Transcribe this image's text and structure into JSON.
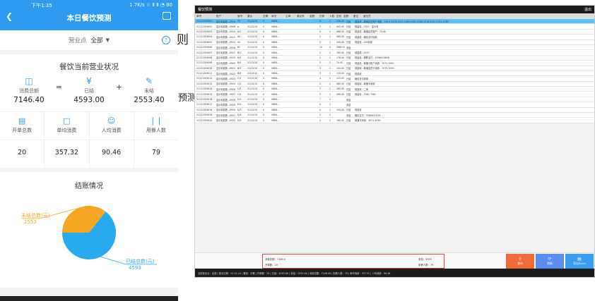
{
  "phone": {
    "status": {
      "time": "下午1:35",
      "net": "1.7K/s ☆ Ⅱ Ⅱ ◔ 80"
    },
    "title": "本日餐饮预测",
    "filter": {
      "label": "营业点",
      "value": "全部"
    },
    "summary": {
      "title": "餐饮当前营业状况",
      "consumption_label": "消费总额",
      "consumption_value": "7146.40",
      "settled_label": "已结",
      "settled_value": "4593.00",
      "unsettled_label": "未结",
      "unsettled_value": "2553.40",
      "op_equals": "=",
      "op_plus": "+"
    },
    "metrics": [
      {
        "label": "开单总数",
        "value": "20"
      },
      {
        "label": "单均消费",
        "value": "357.32"
      },
      {
        "label": "人均消费",
        "value": "90.46"
      },
      {
        "label": "用餐人数",
        "value": "79"
      }
    ],
    "pie": {
      "title": "结账情况",
      "unsettled_label": "未结总数(元)",
      "unsettled_value": "2553",
      "settled_label": "已结总数(元)",
      "settled_value": "4593",
      "colors": {
        "unsettled": "#f5a623",
        "settled": "#29aaee"
      }
    }
  },
  "chart_data": {
    "type": "pie",
    "title": "结账情况",
    "categories": [
      "未结总数(元)",
      "已结总数(元)"
    ],
    "values": [
      2553,
      4593
    ]
  },
  "stray_chars": [
    "则",
    "预测"
  ],
  "desktop": {
    "app_title": "餐饮预测",
    "top_right": "退出",
    "headers": [
      "单号",
      "账户",
      "客号",
      "桌台",
      "日期",
      "单号",
      "主单",
      "桌台号",
      "金额",
      "付款",
      "人数",
      "应收",
      "金额",
      "备注",
      "营业员"
    ],
    "rows": [
      [
        "21121309001",
        "显示标准数...0919",
        "TV",
        "21/12/10",
        "0",
        "V6B4...",
        "",
        "",
        "",
        "8",
        "1",
        "256.40",
        "已结",
        "现金收...普通会员账户消费：256.4,3478,0221,4459,4392,4288,4318,4321,4702,4785"
      ],
      [
        "21121309002",
        "显示标准数...0908",
        "A",
        "21/12/10",
        "0",
        "V6B4...",
        "",
        "",
        "",
        "3",
        "1",
        "402.00",
        "已结",
        "现金收...7007：显示收"
      ],
      [
        "21121309003",
        "显示标准数...0910",
        "A/2",
        "21/12/10",
        "0",
        "V6B4...",
        "",
        "",
        "",
        "3",
        "1",
        "486.00",
        "已结",
        "现金收...普通会员账户：74.40"
      ],
      [
        "21121309004",
        "显示标准数...0912",
        "A3",
        "21/12/10",
        "0",
        "V6B4...",
        "",
        "",
        "",
        "3",
        "1",
        "380.00",
        "已结",
        "现金收...微信支付收款"
      ],
      [
        "21121309005",
        "显示标准数...0914",
        "A5",
        "21/12/10",
        "0",
        "V6B4...",
        "",
        "",
        "",
        "3",
        "1",
        "345.00",
        "已结",
        "现金收...345收款"
      ],
      [
        "21121309006",
        "显示标准数...0916",
        "B2",
        "21/12/10",
        "0",
        "V6B4...",
        "",
        "",
        "",
        "10",
        "4",
        "2680.00",
        "未结",
        ""
      ],
      [
        "21121309007",
        "显示标准数...0917",
        "B/1",
        "21/12/10",
        "0",
        "V6B4...",
        "",
        "",
        "",
        "3",
        "1",
        "785.00",
        "已结",
        "现金收...1437"
      ],
      [
        "21121309008",
        "显示标准数...0919",
        "B/3",
        "21/12/10",
        "0",
        "V6B4...",
        "",
        "",
        "",
        "2",
        "1",
        "178.00",
        "已结",
        "现金收...银联支付：5036070608"
      ],
      [
        "21121309009",
        "显示标准数...0920",
        "B/4",
        "21/12/10",
        "0",
        "V6B4...",
        "",
        "",
        "",
        "3",
        "1",
        "74.00",
        "已结",
        "现金收...普通卡账户消费：7073-7090"
      ],
      [
        "21121309010",
        "显示标准数...0921",
        "B/5",
        "21/12/10",
        "0",
        "V6B4...",
        "",
        "",
        "",
        "3",
        "1",
        "124.00",
        "已结",
        "现金收...普通会员卡消费：7073-7093"
      ],
      [
        "21121309011",
        "显示标准数...0922",
        "B/6",
        "21/12/10",
        "0",
        "V6B4...",
        "",
        "",
        "",
        "3",
        "1",
        "110.00",
        "已结",
        "现金收"
      ],
      [
        "21121309012",
        "显示标准数...0923",
        "C/1",
        "21/12/10",
        "0",
        "V6B4...",
        "",
        "",
        "",
        "4",
        "1",
        "125.00",
        "已结",
        "微信支付收款"
      ],
      [
        "21121309013",
        "显示标准数...0924",
        "C/2",
        "21/12/10",
        "0",
        "V6B4...",
        "",
        "",
        "",
        "3",
        "1",
        "480.00",
        "已结",
        "现金收...普通卡消费"
      ],
      [
        "21121309014",
        "显示标准数...0926",
        "C/3",
        "21/12/10",
        "0",
        "V6B4...",
        "",
        "",
        "",
        "3",
        "1",
        "265.00",
        "已结",
        "现金收...二单"
      ],
      [
        "21121309015",
        "显示标准数...0927",
        "C/4",
        "21/12/10",
        "0",
        "V6B4...",
        "",
        "",
        "",
        "3",
        "1",
        "490.00",
        "已结",
        "现金收...7062-7082"
      ],
      [
        "21121309016",
        "显示标准数...0928",
        "D/1",
        "21/12/10",
        "0",
        "V6B4...",
        "",
        "",
        "",
        "7",
        "1",
        "",
        "未结",
        ""
      ],
      [
        "21121309017",
        "显示标准数...0929",
        "D/2",
        "21/12/10",
        "0",
        "V6B4...",
        "",
        "",
        "",
        "4",
        "1",
        "",
        "未结",
        ""
      ],
      [
        "21121309018",
        "显示标准数...0930",
        "D/3",
        "21/12/10",
        "0",
        "V6B4...",
        "",
        "",
        "",
        "4",
        "1",
        "100.00",
        "已结",
        "现金收"
      ],
      [
        "21121309019",
        "显示标准数...0931",
        "D/4",
        "21/12/10",
        "0",
        "V6B4...",
        "",
        "",
        "",
        "3",
        "1",
        "",
        "未结",
        "微信支付：3280637029"
      ],
      [
        "21121309020",
        "显示标准数...0932",
        "D/5",
        "21/12/10",
        "0",
        "V6B4...",
        "",
        "",
        "",
        "4",
        "1",
        "160.00",
        "已结",
        "普通卡消费：4072-4090"
      ]
    ],
    "stats": {
      "total_label": "消费总额：7146.4",
      "open_label": "开单数：20",
      "unsettled_label": "未结：4593",
      "people_label": "用餐人数：79"
    },
    "buttons": [
      {
        "label": "查询",
        "color": "#f06a3a"
      },
      {
        "label": "刷新",
        "color": "#5b8cf0"
      },
      {
        "label": "导出Excel",
        "color": "#3a9ef0"
      }
    ],
    "statusbar": "当前营业点：全部 | 营业日期：21-12-10 | 餐段：中餐 | 开单数：20 | 已结：4593.00 | 未结：2553.40 | 消费总额：7146.40 | 用餐人数：79 | 单均消费：357.32 | 人均消费：90.46"
  }
}
